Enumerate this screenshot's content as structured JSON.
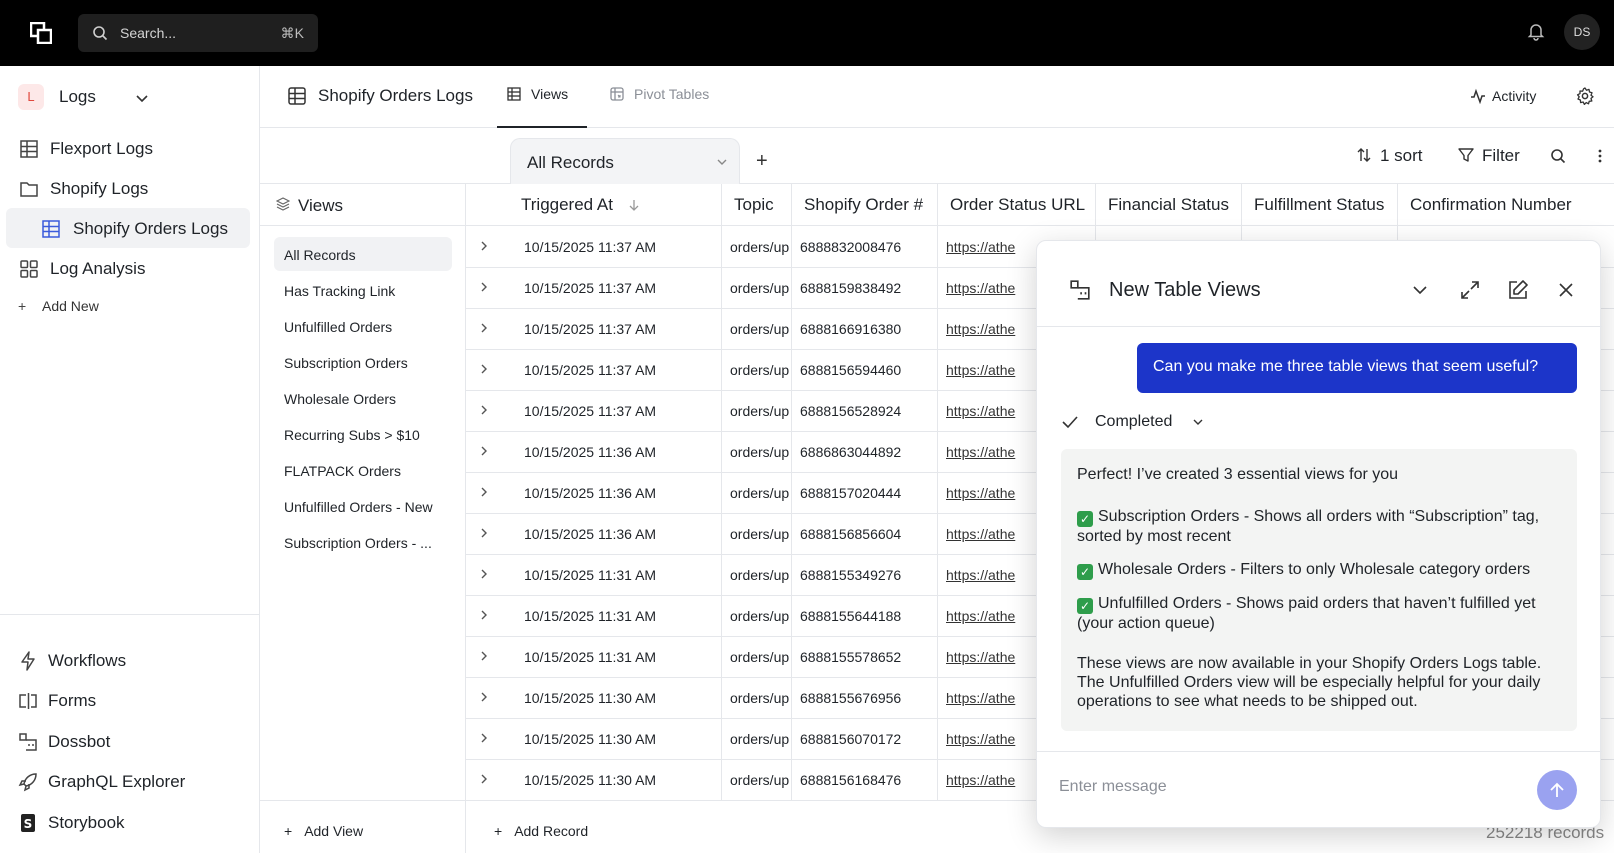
{
  "topbar": {
    "search_placeholder": "Search...",
    "search_shortcut": "⌘K",
    "avatar_initials": "DS"
  },
  "sidebar": {
    "workspace_badge": "L",
    "workspace_name": "Logs",
    "items": [
      {
        "label": "Flexport Logs",
        "icon": "table-icon"
      },
      {
        "label": "Shopify Logs",
        "icon": "folder-icon"
      },
      {
        "label": "Shopify Orders Logs",
        "icon": "table-icon",
        "active": true
      },
      {
        "label": "Log Analysis",
        "icon": "grid-icon"
      }
    ],
    "add_new": "Add New",
    "bottom_items": [
      {
        "label": "Workflows",
        "icon": "bolt-icon"
      },
      {
        "label": "Forms",
        "icon": "form-icon"
      },
      {
        "label": "Dossbot",
        "icon": "dossbot-icon"
      },
      {
        "label": "GraphQL Explorer",
        "icon": "rocket-icon"
      },
      {
        "label": "Storybook",
        "icon": "storybook-icon"
      }
    ]
  },
  "header": {
    "title": "Shopify Orders Logs",
    "tabs": [
      {
        "label": "Views",
        "active": true
      },
      {
        "label": "Pivot Tables",
        "active": false
      }
    ],
    "activity": "Activity"
  },
  "toolbar": {
    "current_view": "All Records",
    "sort": "1 sort",
    "filter": "Filter"
  },
  "views_panel": {
    "title": "Views",
    "items": [
      "All Records",
      "Has Tracking Link",
      "Unfulfilled Orders",
      "Subscription Orders",
      "Wholesale Orders",
      "Recurring Subs > $10",
      "FLATPACK Orders",
      "Unfulfilled Orders - New",
      "Subscription Orders - ..."
    ],
    "add_view": "Add View"
  },
  "table": {
    "columns": [
      "Triggered At",
      "Topic",
      "Shopify Order #",
      "Order Status URL",
      "Financial Status",
      "Fulfillment Status",
      "Confirmation Number"
    ],
    "rows": [
      [
        "10/15/2025 11:37 AM",
        "orders/up",
        "6888832008476",
        "https://athe"
      ],
      [
        "10/15/2025 11:37 AM",
        "orders/up",
        "6888159838492",
        "https://athe"
      ],
      [
        "10/15/2025 11:37 AM",
        "orders/up",
        "6888166916380",
        "https://athe"
      ],
      [
        "10/15/2025 11:37 AM",
        "orders/up",
        "6888156594460",
        "https://athe"
      ],
      [
        "10/15/2025 11:37 AM",
        "orders/up",
        "6888156528924",
        "https://athe"
      ],
      [
        "10/15/2025 11:36 AM",
        "orders/up",
        "6886863044892",
        "https://athe"
      ],
      [
        "10/15/2025 11:36 AM",
        "orders/up",
        "6888157020444",
        "https://athe"
      ],
      [
        "10/15/2025 11:36 AM",
        "orders/up",
        "6888156856604",
        "https://athe"
      ],
      [
        "10/15/2025 11:31 AM",
        "orders/up",
        "6888155349276",
        "https://athe"
      ],
      [
        "10/15/2025 11:31 AM",
        "orders/up",
        "6888155644188",
        "https://athe"
      ],
      [
        "10/15/2025 11:31 AM",
        "orders/up",
        "6888155578652",
        "https://athe"
      ],
      [
        "10/15/2025 11:30 AM",
        "orders/up",
        "6888155676956",
        "https://athe"
      ],
      [
        "10/15/2025 11:30 AM",
        "orders/up",
        "6888156070172",
        "https://athe"
      ],
      [
        "10/15/2025 11:30 AM",
        "orders/up",
        "6888156168476",
        "https://athe"
      ]
    ],
    "add_record": "Add Record",
    "record_count": "252218 records"
  },
  "chat": {
    "title": "New Table Views",
    "user_message": "Can you make me three table views that seem useful?",
    "status": "Completed",
    "reply_intro": "Perfect! I’ve created 3 essential views for you",
    "reply_items": [
      "Subscription Orders - Shows all orders with “Subscription” tag, sorted by most recent",
      "Wholesale Orders - Filters to only Wholesale category orders",
      "Unfulfilled Orders - Shows paid orders that haven’t fulfilled yet (your action queue)"
    ],
    "reply_outro": "These views are now available in your Shopify Orders Logs table. The Unfulfilled Orders view will be especially helpful for your daily operations to see what needs to be shipped out.",
    "input_placeholder": "Enter message"
  },
  "colors": {
    "accent": "#1c35c9",
    "send_button": "#9aa2f0",
    "check": "#2e9d4b",
    "topbar": "#000000"
  }
}
